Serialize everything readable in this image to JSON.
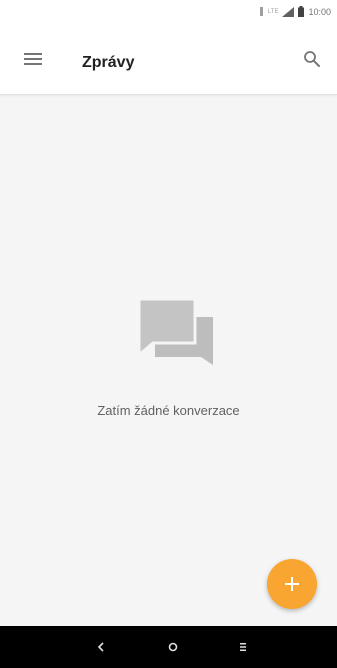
{
  "status_bar": {
    "time": "10:00",
    "network_label": "LTE",
    "icons": [
      "vibrate-icon",
      "signal-icon",
      "battery-icon"
    ]
  },
  "app_bar": {
    "title": "Zprávy",
    "icons": [
      "menu-icon",
      "search-icon"
    ]
  },
  "empty_state": {
    "icon": "conversation-bubbles-icon",
    "text": "Zatím žádné konverzace"
  },
  "fab": {
    "icon": "plus-icon",
    "color": "#f8a532"
  },
  "nav_bar": {
    "buttons": [
      "back-icon",
      "home-icon",
      "recents-icon"
    ]
  },
  "colors": {
    "accent": "#f8a532",
    "background": "#f5f5f5",
    "empty_icon": "#bdbdbd"
  }
}
